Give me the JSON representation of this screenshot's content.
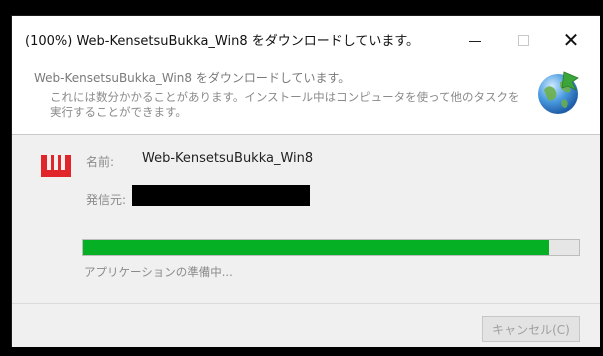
{
  "window": {
    "title": "(100%) Web-KensetsuBukka_Win8 をダウンロードしています。",
    "controls": {
      "minimize": "—",
      "maximize": "",
      "close": "✕"
    }
  },
  "header": {
    "title": "Web-KensetsuBukka_Win8 をダウンロードしています。",
    "description": "これには数分かかることがあります。インストール中はコンピュータを使って他のタスクを実行することができます。",
    "icon": "globe-install-icon"
  },
  "details": {
    "app_icon": "app-logo-icon",
    "app_icon_color": "#e0262b",
    "name_label": "名前:",
    "name_value": "Web-KensetsuBukka_Win8",
    "publisher_label": "発信元:",
    "publisher_value_redacted": true
  },
  "progress": {
    "percent": 94,
    "color": "#06b025",
    "status": "アプリケーションの準備中..."
  },
  "footer": {
    "cancel_label": "キャンセル(C)"
  }
}
